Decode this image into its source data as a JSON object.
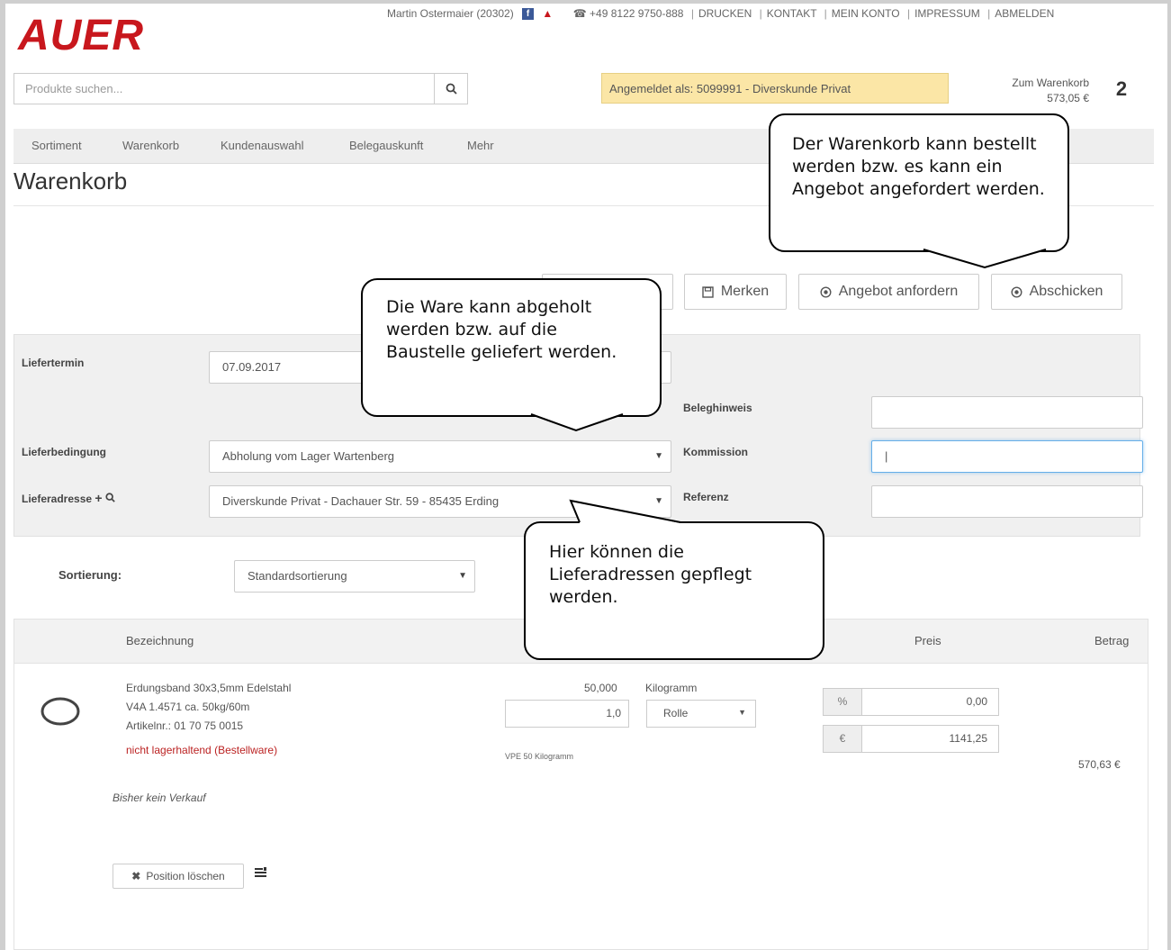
{
  "brand": "AUER",
  "topbar": {
    "user": "Martin Ostermaier (20302)",
    "phone": "☎ +49 8122 9750-888",
    "links": [
      "DRUCKEN",
      "KONTAKT",
      "MEIN KONTO",
      "IMPRESSUM",
      "ABMELDEN"
    ]
  },
  "search": {
    "placeholder": "Produkte suchen..."
  },
  "login_notice": "Angemeldet als: 5099991 - Diverskunde Privat",
  "cart": {
    "label": "Zum Warenkorb",
    "total": "573,05 €",
    "count": "2"
  },
  "nav": [
    "Sortiment",
    "Warenkorb",
    "Kundenauswahl",
    "Belegauskunft",
    "Mehr"
  ],
  "page_title": "Warenkorb",
  "actions": {
    "save": "Merken",
    "quote": "Angebot anfordern",
    "submit": "Abschicken"
  },
  "form": {
    "liefertermin_label": "Liefertermin",
    "liefertermin_value": "07.09.2017",
    "beleghinweis_label": "Beleghinweis",
    "lieferbedingung_label": "Lieferbedingung",
    "lieferbedingung_value": "Abholung vom Lager Wartenberg",
    "kommission_label": "Kommission",
    "kommission_value": "|",
    "lieferadresse_label": "Lieferadresse",
    "lieferadresse_value": "Diverskunde Privat - Dachauer Str. 59 - 85435 Erding",
    "referenz_label": "Referenz"
  },
  "sort": {
    "label": "Sortierung:",
    "value": "Standardsortierung"
  },
  "table": {
    "headers": {
      "bezeichnung": "Bezeichnung",
      "preis": "Preis",
      "betrag": "Betrag"
    },
    "item": {
      "line1": "Erdungsband 30x3,5mm Edelstahl",
      "line2": "V4A 1.4571 ca. 50kg/60m",
      "artnr": "Artikelnr.: 01 70 75 0015",
      "stock": "nicht lagerhaltend (Bestellware)",
      "qty_total": "50,000",
      "unit": "Kilogramm",
      "qty_input": "1,0",
      "pack_unit": "Rolle",
      "vpe": "VPE 50 Kilogramm",
      "discount_addon": "%",
      "discount": "0,00",
      "price_addon": "€",
      "price": "1141,25",
      "amount": "570,63 €",
      "history": "Bisher kein Verkauf",
      "delete_label": "Position löschen"
    }
  },
  "callouts": {
    "cart": "Der Warenkorb kann bestellt werden bzw. es kann ein Angebot angefordert werden.",
    "delivery": "Die Ware kann abgeholt werden bzw. auf die Baustelle geliefert werden.",
    "address": "Hier können die Lieferadressen gepflegt werden."
  },
  "colors": {
    "brand_red": "#c8171d",
    "notice_bg": "#fbe6a6"
  }
}
